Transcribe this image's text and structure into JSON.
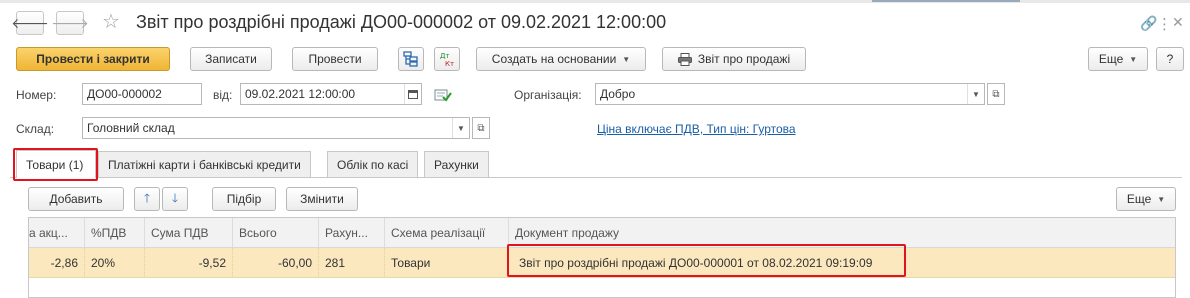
{
  "window": {
    "title": "Звіт про роздрібні продажі ДО00-000002 от 09.02.2021 12:00:00",
    "back_glyph": "🡐",
    "forward_glyph": "🡒",
    "star_glyph": "☆",
    "link_glyph": "🔗",
    "more_glyph": "⋮",
    "close_glyph": "✕"
  },
  "toolbar": {
    "post_close": "Провести і закрити",
    "save": "Записати",
    "post": "Провести",
    "create_based": "Создать на основании",
    "sales_report": "Звіт про продажі",
    "more": "Еще",
    "help": "?"
  },
  "form": {
    "number_label": "Номер:",
    "number_value": "ДО00-000002",
    "date_label": "від:",
    "date_value": "09.02.2021 12:00:00",
    "org_label": "Організація:",
    "org_value": "Добро",
    "warehouse_label": "Склад:",
    "warehouse_value": "Головний склад",
    "price_link": "Ціна включає ПДВ, Тип цін: Гуртова"
  },
  "tabs": [
    {
      "label": "Товари (1)"
    },
    {
      "label": "Платіжні карти і банківські кредити"
    },
    {
      "label": "Облік по касі"
    },
    {
      "label": "Рахунки"
    }
  ],
  "grid_toolbar": {
    "add": "Добавить",
    "up_glyph": "🡑",
    "down_glyph": "🡓",
    "pick": "Підбір",
    "change": "Змінити",
    "more": "Еще"
  },
  "table": {
    "columns": [
      "а акц...",
      "%ПДВ",
      "Сума ПДВ",
      "Всього",
      "Рахун...",
      "Схема реалізації",
      "Документ продажу"
    ],
    "rows": [
      [
        "-2,86",
        "20%",
        "-9,52",
        "-60,00",
        "281",
        "Товари",
        "Звіт про роздрібні продажі ДО00-000001 от 08.02.2021 09:19:09"
      ]
    ]
  },
  "colors": {
    "primary_button": "#f0b535",
    "highlight_box": "#e0141c",
    "selected_row": "#fbe8bf",
    "link": "#1a5ea8"
  }
}
